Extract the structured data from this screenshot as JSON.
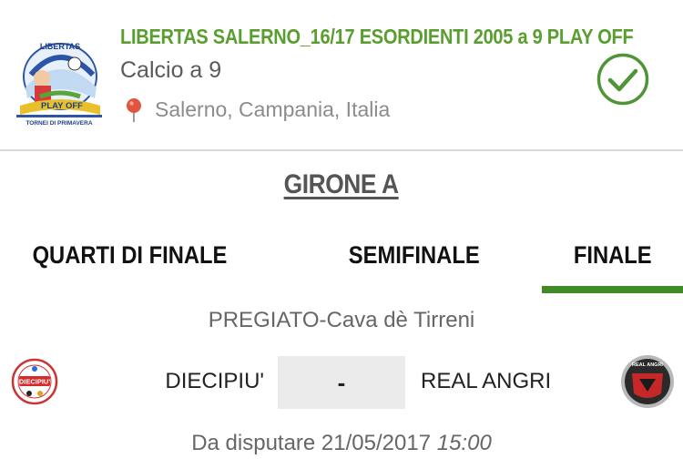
{
  "header": {
    "title": "LIBERTAS SALERNO_16/17 ESORDIENTI 2005 a 9 PLAY OFF",
    "sport": "Calcio a 9",
    "location": "Salerno, Campania, Italia",
    "logo_text": [
      "LIBERTAS",
      "PLAY OFF",
      "TORNEI DI PRIMAVERA"
    ],
    "accent_color": "#5a9e2f",
    "status_icon": "check-circle-icon"
  },
  "group": {
    "label": "GIRONE A"
  },
  "tabs": [
    {
      "label": "QUARTI DI FINALE",
      "active": false
    },
    {
      "label": "SEMIFINALE",
      "active": false
    },
    {
      "label": "FINALE",
      "active": true
    }
  ],
  "match": {
    "venue": "PREGIATO-Cava dè Tirreni",
    "home_team": "DIECIPIU'",
    "away_team": "REAL ANGRI",
    "score": "-",
    "home_logo_text": "DIECIPIU'",
    "away_logo_text": "REAL ANGRI",
    "status_prefix": "Da disputare 21/05/2017",
    "status_time": "15:00"
  }
}
